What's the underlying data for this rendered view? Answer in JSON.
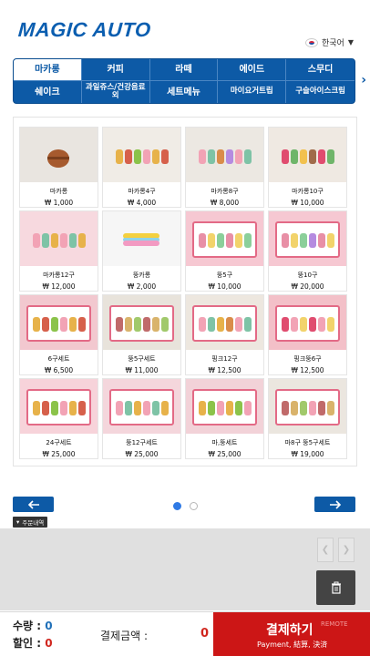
{
  "brand": {
    "logo_text": "MAGIC AUTO"
  },
  "language": {
    "label": "한국어"
  },
  "categories": [
    {
      "label": "마카롱",
      "active": true
    },
    {
      "label": "커피"
    },
    {
      "label": "라떼"
    },
    {
      "label": "에이드"
    },
    {
      "label": "스무디"
    },
    {
      "label": "쉐이크"
    },
    {
      "label": "과일쥬스/건강음료 외"
    },
    {
      "label": "세트메뉴"
    },
    {
      "label": "마이요거트립"
    },
    {
      "label": "구슬아이스크림"
    }
  ],
  "products": [
    {
      "name": "마카롱",
      "price": "₩ 1,000"
    },
    {
      "name": "마카롱4구",
      "price": "₩ 4,000"
    },
    {
      "name": "마카롱8구",
      "price": "₩ 8,000"
    },
    {
      "name": "마카롱10구",
      "price": "₩ 10,000"
    },
    {
      "name": "마카롱12구",
      "price": "₩ 12,000"
    },
    {
      "name": "뚱카롱",
      "price": "₩ 2,000"
    },
    {
      "name": "뚱5구",
      "price": "₩ 10,000"
    },
    {
      "name": "뚱10구",
      "price": "₩ 20,000"
    },
    {
      "name": "6구세트",
      "price": "₩ 6,500"
    },
    {
      "name": "뚱5구세트",
      "price": "₩ 11,000"
    },
    {
      "name": "핑크12구",
      "price": "₩ 12,500"
    },
    {
      "name": "핑크뚱6구",
      "price": "₩ 12,500"
    },
    {
      "name": "24구세트",
      "price": "₩ 25,000"
    },
    {
      "name": "뚱12구세트",
      "price": "₩ 25,000"
    },
    {
      "name": "마,뚱세트",
      "price": "₩ 25,000"
    },
    {
      "name": "마8구 뚱5구세트",
      "price": "₩ 19,000"
    }
  ],
  "pagination": {
    "current_page": 1,
    "total_pages": 2
  },
  "order_history": {
    "label": "주문내역"
  },
  "summary": {
    "qty_label": "수량 :",
    "qty_value": "0",
    "discount_label": "할인 :",
    "discount_value": "0",
    "amount_label": "결제금액 :",
    "amount_value": "0"
  },
  "pay": {
    "label": "결제하기",
    "sub_label": "Payment, 結算, 決済",
    "remote_label": "REMOTE"
  },
  "colors": {
    "brand_blue": "#0d5aa6",
    "pay_red": "#cc1616",
    "price_red": "#d0261e"
  }
}
